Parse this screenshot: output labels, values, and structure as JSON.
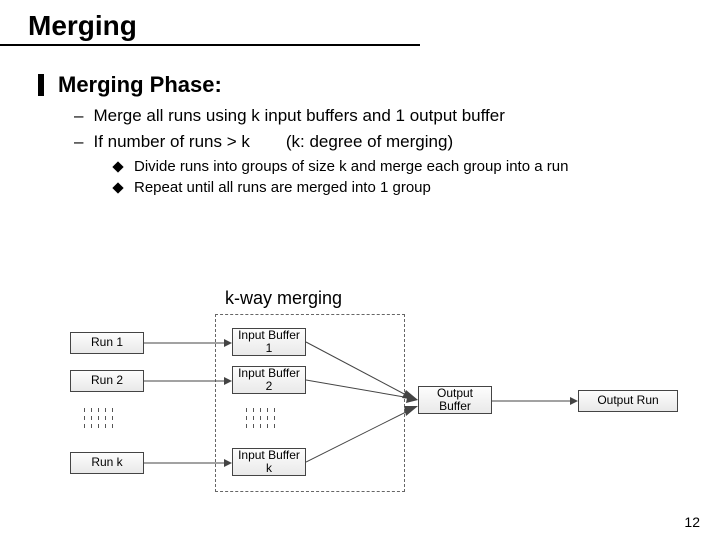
{
  "title": "Merging",
  "l1_text": "Merging Phase:",
  "bullets": {
    "b1": "Merge all runs using k input buffers and 1 output buffer",
    "b2_a": "If number of runs > k",
    "b2_b": "(k: degree of merging)",
    "sub1": "Divide runs into groups of size k and merge each group into a run",
    "sub2": "Repeat until all runs are merged into 1 group"
  },
  "kway": "k-way merging",
  "boxes": {
    "run1": "Run 1",
    "run2": "Run 2",
    "runk": "Run k",
    "ib1": "Input Buffer 1",
    "ib2": "Input Buffer 2",
    "ibk": "Input Buffer k",
    "ob": "Output Buffer",
    "or": "Output Run"
  },
  "page": "12"
}
